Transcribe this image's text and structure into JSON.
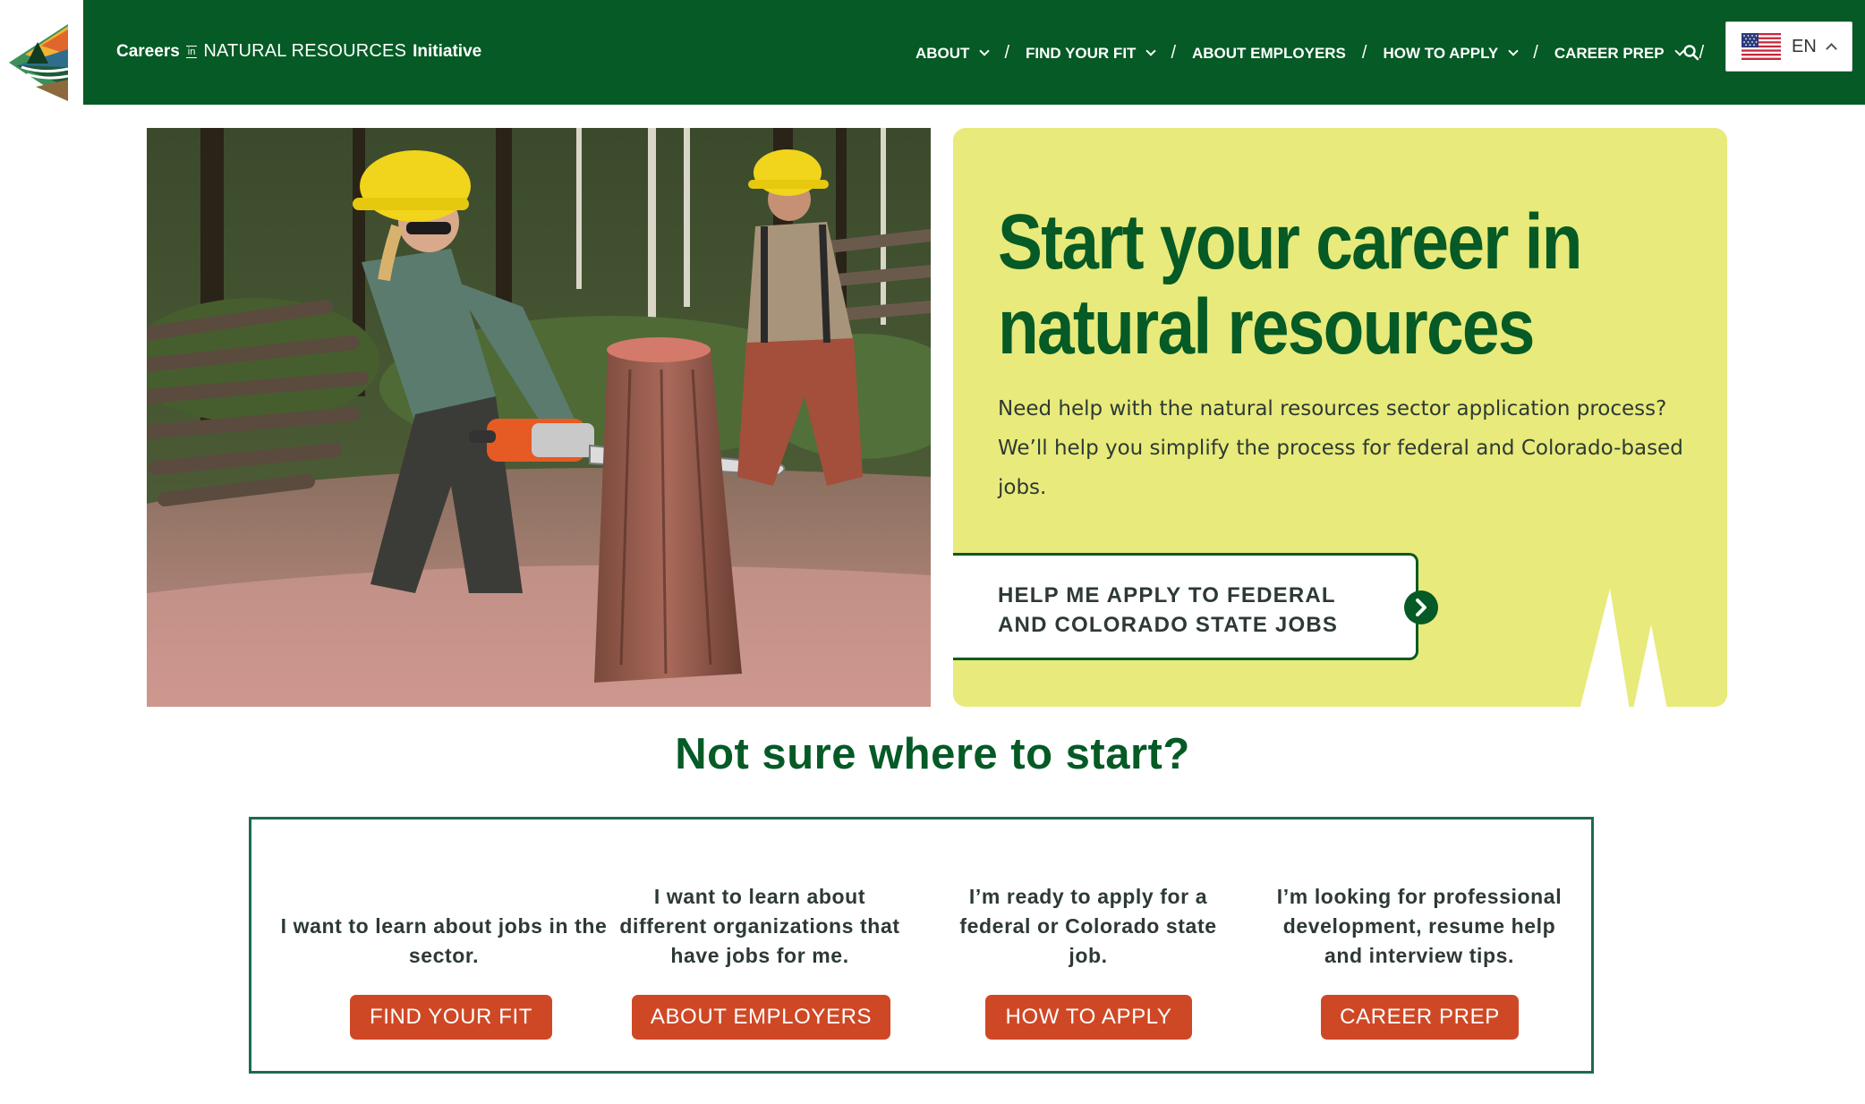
{
  "header": {
    "logo": {
      "icon": "mountain-sun-logo-icon"
    },
    "brand": {
      "careers": "Careers",
      "in": "in",
      "natural_resources": "NATURAL RESOURCES",
      "initiative": "Initiative"
    },
    "nav": [
      {
        "label": "ABOUT",
        "dropdown": true
      },
      {
        "label": "FIND YOUR FIT",
        "dropdown": true
      },
      {
        "label": "ABOUT EMPLOYERS",
        "dropdown": false
      },
      {
        "label": "HOW TO APPLY",
        "dropdown": true
      },
      {
        "label": "CAREER PREP",
        "dropdown": true
      }
    ],
    "separator": "/",
    "search_icon": "search-icon",
    "language": {
      "code": "EN",
      "flag": "us-flag-icon"
    }
  },
  "hero": {
    "image": "forestry-workers-chainsaw-photo",
    "title": "Start your career in natural resources",
    "description": "Need help with the natural resources sector application process? We’ll help you simplify the process for federal and Colorado-based jobs.",
    "cta_label": "HELP ME APPLY TO FEDERAL AND COLORADO STATE JOBS"
  },
  "section": {
    "title": "Not sure where to start?"
  },
  "options": [
    {
      "text": "I want to learn about jobs in the sector.",
      "button": "FIND YOUR FIT"
    },
    {
      "text": "I want to learn about different organizations that have jobs for me.",
      "button": "ABOUT EMPLOYERS"
    },
    {
      "text": "I’m ready to apply for a federal or Colorado state job.",
      "button": "HOW TO APPLY"
    },
    {
      "text": "I’m looking for professional development, resume help and interview tips.",
      "button": "CAREER PREP"
    }
  ],
  "colors": {
    "brand_green": "#055a25",
    "hero_card": "#e8ea7b",
    "button_orange": "#cf4825",
    "box_border": "#1c6b4f"
  }
}
